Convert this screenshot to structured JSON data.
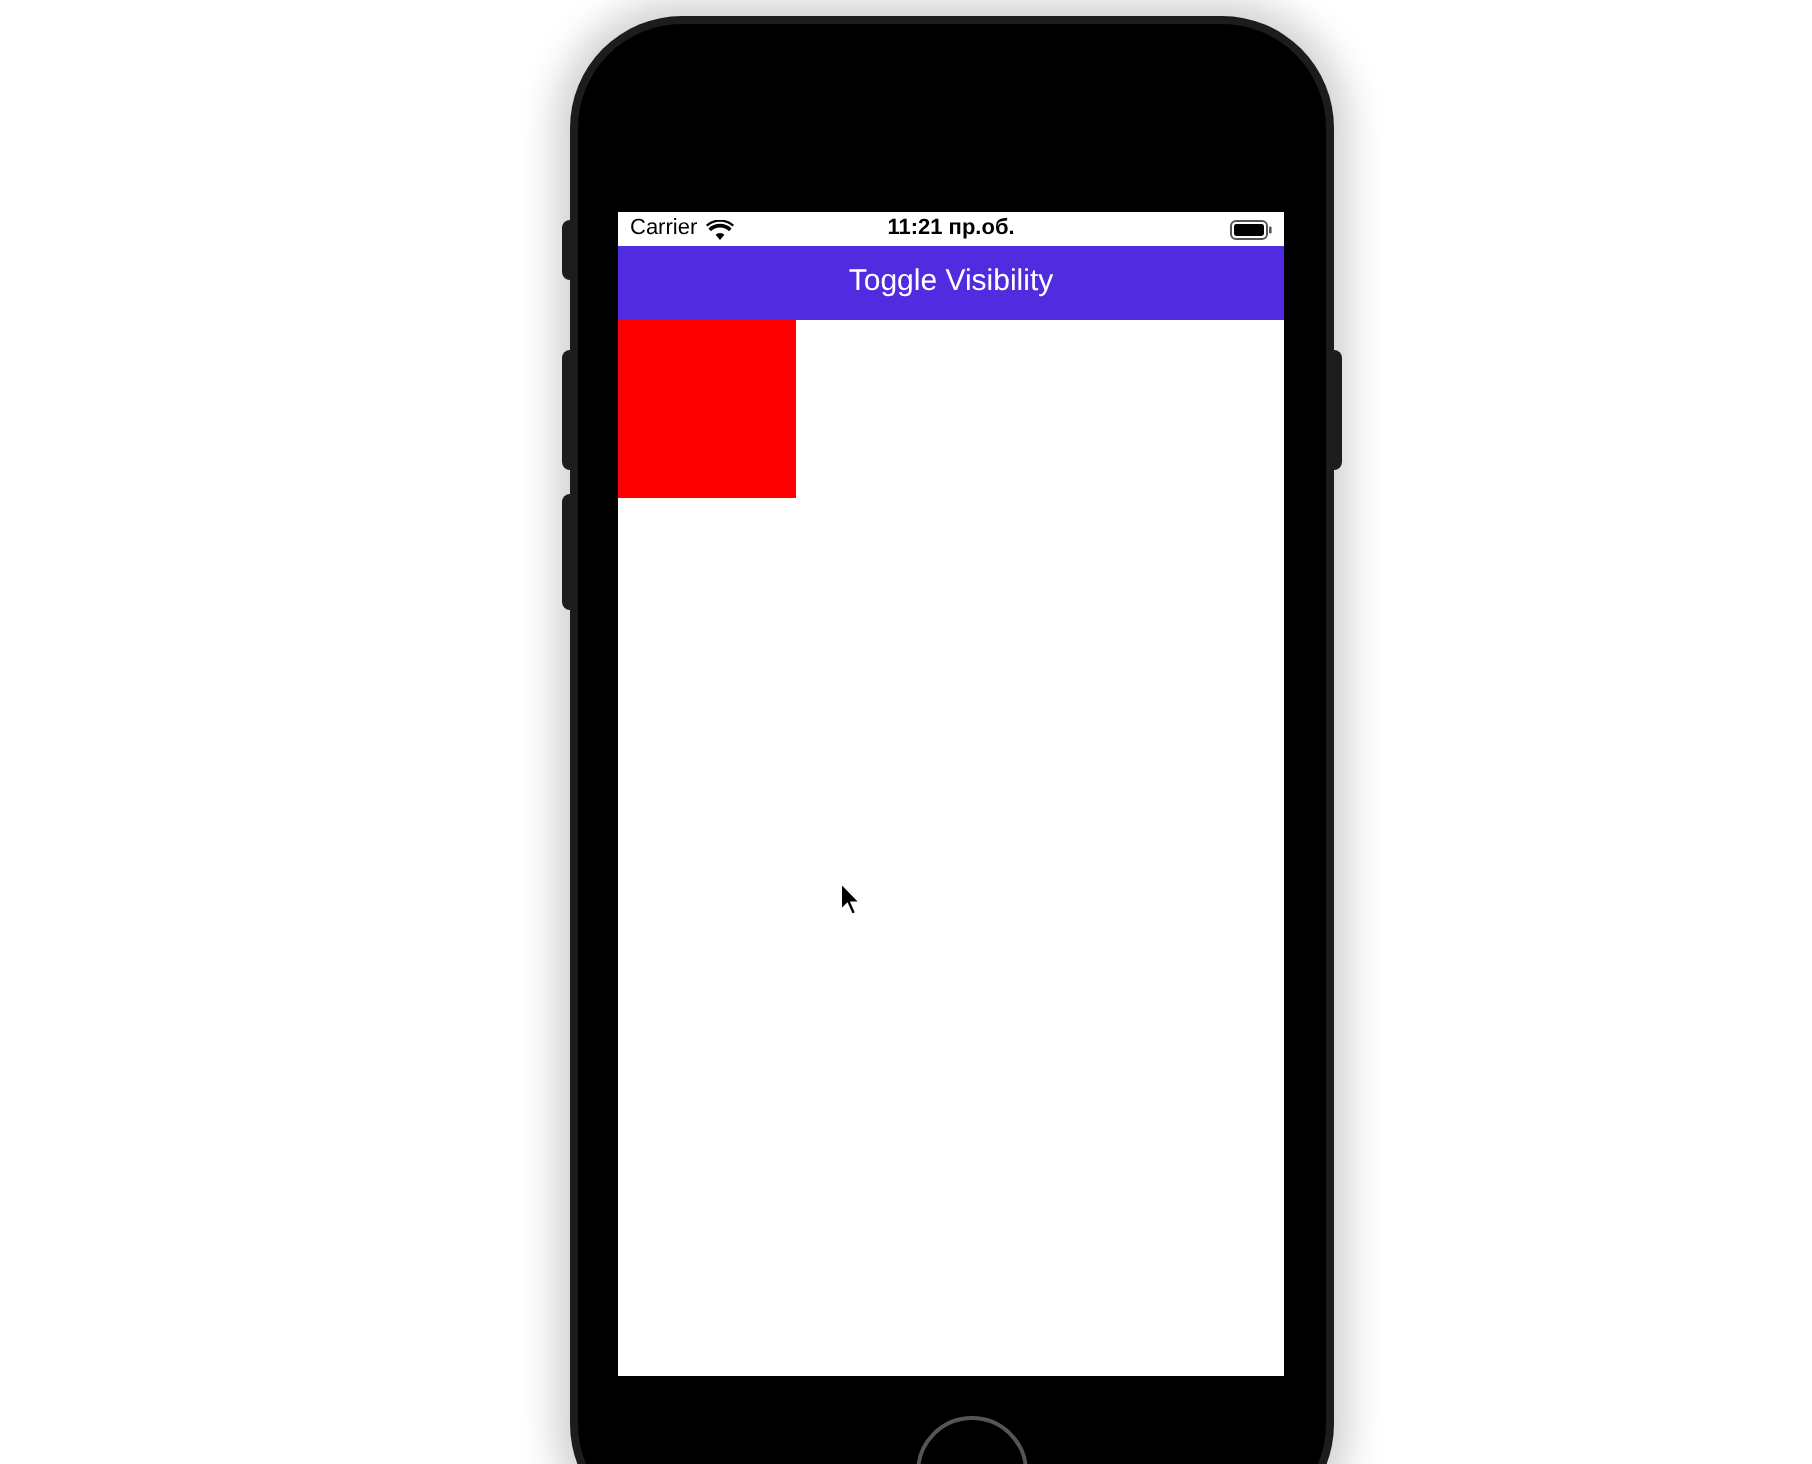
{
  "status_bar": {
    "carrier": "Carrier",
    "time": "11:21 пр.об."
  },
  "nav_bar": {
    "title": "Toggle Visibility"
  },
  "red_box": {
    "visible": true
  }
}
